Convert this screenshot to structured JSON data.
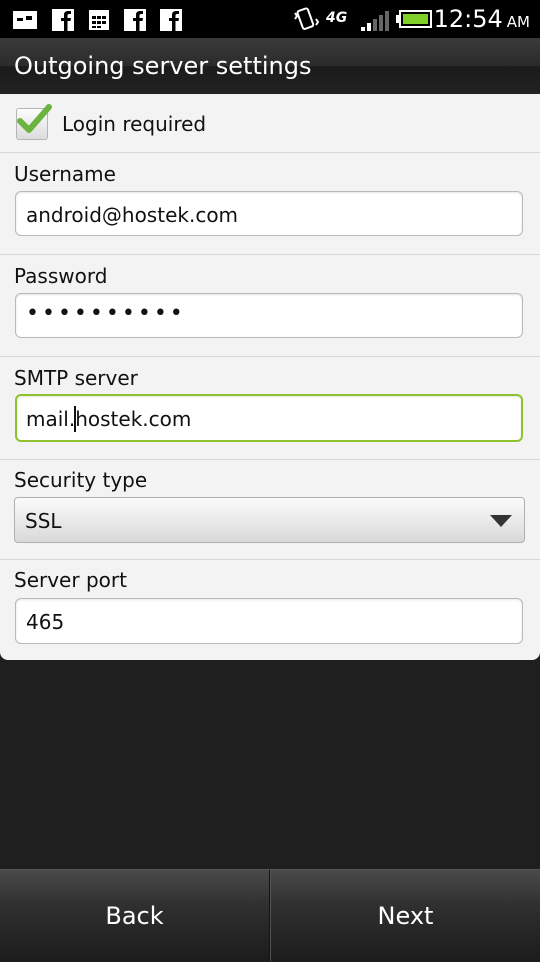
{
  "status_bar": {
    "time": "12:54",
    "ampm": "AM",
    "network": "4G",
    "icons": [
      "message-icon",
      "facebook-icon",
      "calendar-icon",
      "facebook-icon",
      "facebook-icon",
      "vibrate-icon",
      "signal-icon",
      "battery-icon"
    ]
  },
  "title": "Outgoing server settings",
  "login_required": {
    "label": "Login required",
    "checked": true
  },
  "username": {
    "label": "Username",
    "value": "android@hostek.com"
  },
  "password": {
    "label": "Password",
    "value": "••••••••••"
  },
  "smtp": {
    "label": "SMTP server",
    "value_before": "mail.",
    "value_after": "hostek.com"
  },
  "security": {
    "label": "Security type",
    "value": "SSL"
  },
  "port": {
    "label": "Server port",
    "value": "465"
  },
  "buttons": {
    "back": "Back",
    "next": "Next"
  },
  "colors": {
    "focus_accent": "#8fc32d",
    "check": "#6db33f"
  }
}
